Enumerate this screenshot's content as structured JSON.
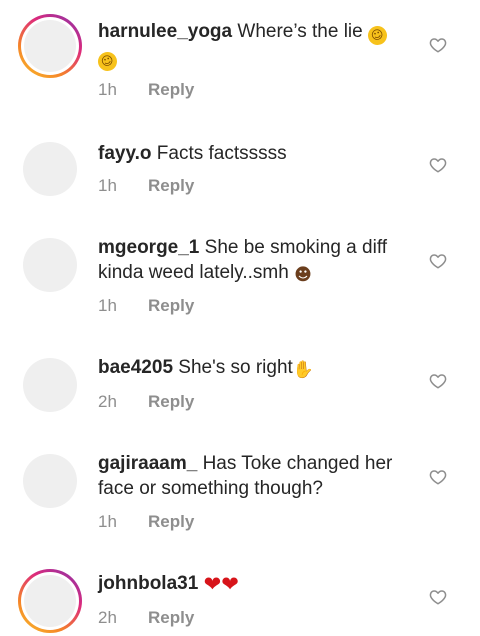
{
  "comments": [
    {
      "username": "harnulee_yoga",
      "text": "Where’s the lie",
      "emoji_icon": "rolling-on-floor-laughing-icon",
      "emoji_count": 2,
      "time": "1h",
      "reply_label": "Reply",
      "has_story_ring": true
    },
    {
      "username": "fayy.o",
      "text": "Facts factsssss",
      "time": "1h",
      "reply_label": "Reply",
      "has_story_ring": false
    },
    {
      "username": "mgeorge_1",
      "text": "She be smoking a diff kinda weed lately..smh",
      "emoji_icon": "man-facepalming-icon",
      "time": "1h",
      "reply_label": "Reply",
      "has_story_ring": false
    },
    {
      "username": "bae4205",
      "text": "She's so right",
      "emoji_icon": "raising-hands-icon",
      "time": "2h",
      "reply_label": "Reply",
      "has_story_ring": false
    },
    {
      "username": "gajiraaam_",
      "text": "Has Toke changed her face or something though?",
      "time": "1h",
      "reply_label": "Reply",
      "has_story_ring": false
    },
    {
      "username": "johnbola31",
      "text": "",
      "emoji_icon": "red-heart-icon",
      "emoji_count": 2,
      "time": "2h",
      "reply_label": "Reply",
      "has_story_ring": true
    }
  ],
  "colors": {
    "text": "#262626",
    "secondary_text": "#8e8e8e",
    "avatar_placeholder": "#efefef",
    "story_ring_start": "#f9c02b",
    "story_ring_end": "#8134af",
    "heart_emoji": "#d7141a",
    "laugh_emoji": "#f7c21b"
  }
}
